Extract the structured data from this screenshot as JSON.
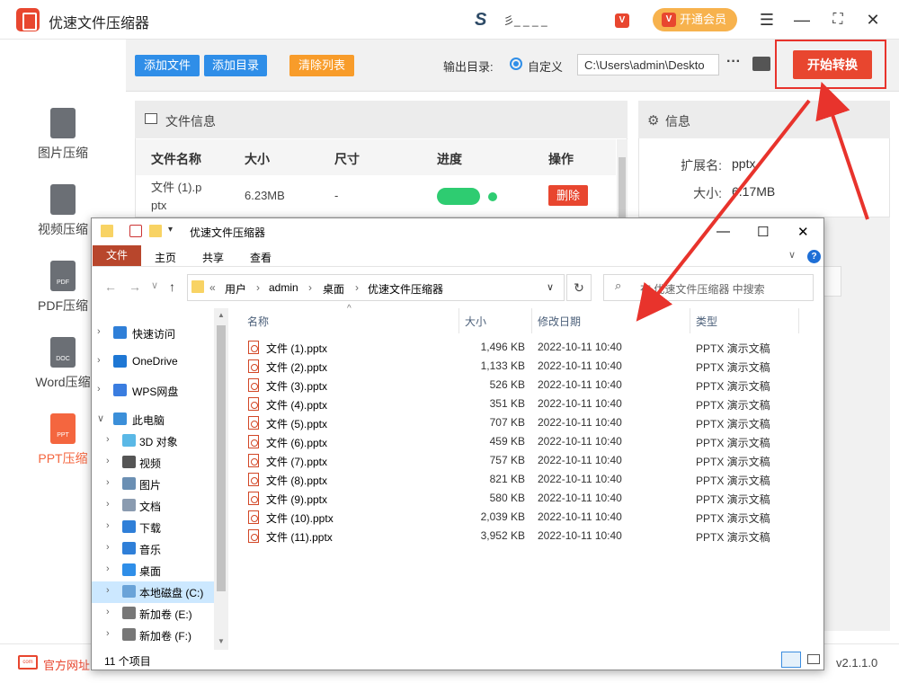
{
  "app": {
    "title": "优速文件压缩器",
    "user_name": "彡_ _ _ _",
    "vip_badge": "V",
    "vip_button": "开通会员",
    "vip_k": "V",
    "controls": {
      "menu": "☰",
      "minimize": "—",
      "maximize": "⛶",
      "close": "✕"
    }
  },
  "nav": {
    "items": [
      {
        "label": "图片压缩",
        "icon": "image-file-icon",
        "active": false
      },
      {
        "label": "视频压缩",
        "icon": "video-file-icon",
        "active": false
      },
      {
        "label": "PDF压缩",
        "icon": "pdf-file-icon",
        "icon_text": "PDF",
        "active": false
      },
      {
        "label": "Word压缩",
        "icon": "doc-file-icon",
        "icon_text": "DOC",
        "active": false
      },
      {
        "label": "PPT压缩",
        "icon": "ppt-file-icon",
        "icon_text": "PPT",
        "active": true
      }
    ]
  },
  "toolbar": {
    "add_file": "添加文件",
    "add_folder": "添加目录",
    "clear_list": "清除列表",
    "output_label": "输出目录:",
    "radio_label": "自定义",
    "output_path": "C:\\Users\\admin\\Deskto",
    "more": "···",
    "start": "开始转换"
  },
  "file_panel": {
    "title": "文件信息",
    "columns": [
      "文件名称",
      "大小",
      "尺寸",
      "进度",
      "操作"
    ],
    "row": {
      "name": "文件 (1).p\nptx",
      "size": "6.23MB",
      "dims": "-",
      "action": "删除"
    }
  },
  "info_panel": {
    "title": "信息",
    "ext_label": "扩展名:",
    "ext_value": "pptx",
    "size_label": "大小:",
    "size_value": "6.17MB"
  },
  "bottom": {
    "site_label": "官方网址",
    "site_icon": "com",
    "version": "v2.1.1.0"
  },
  "explorer": {
    "title": "优速文件压缩器",
    "ribbon_tabs": [
      "文件",
      "主页",
      "共享",
      "查看"
    ],
    "breadcrumb": [
      "«",
      "用户",
      "›",
      "admin",
      "›",
      "桌面",
      "›",
      "优速文件压缩器"
    ],
    "search_placeholder": "在 优速文件压缩器 中搜索",
    "columns": {
      "name": "名称",
      "size": "大小",
      "date": "修改日期",
      "type": "类型"
    },
    "tree": [
      {
        "label": "快速访问",
        "icon": "star-icon",
        "color": "#2f7fd8",
        "indent": 0,
        "selected": false,
        "expanded": false
      },
      {
        "label": "OneDrive",
        "icon": "cloud-icon",
        "color": "#1e77d4",
        "indent": 0,
        "selected": false,
        "expanded": false
      },
      {
        "label": "WPS网盘",
        "icon": "wps-cloud-icon",
        "color": "#3a7de0",
        "indent": 0,
        "selected": false,
        "expanded": false
      },
      {
        "label": "此电脑",
        "icon": "computer-icon",
        "color": "#3b8fd9",
        "indent": 0,
        "selected": false,
        "expanded": true
      },
      {
        "label": "3D 对象",
        "icon": "3d-objects-icon",
        "color": "#5ab8e6",
        "indent": 1,
        "selected": false,
        "expanded": false
      },
      {
        "label": "视频",
        "icon": "video-folder-icon",
        "color": "#555555",
        "indent": 1,
        "selected": false,
        "expanded": false
      },
      {
        "label": "图片",
        "icon": "pictures-folder-icon",
        "color": "#6b8fb3",
        "indent": 1,
        "selected": false,
        "expanded": false
      },
      {
        "label": "文档",
        "icon": "documents-folder-icon",
        "color": "#8a9bb0",
        "indent": 1,
        "selected": false,
        "expanded": false
      },
      {
        "label": "下载",
        "icon": "downloads-folder-icon",
        "color": "#2f7fd8",
        "indent": 1,
        "selected": false,
        "expanded": false
      },
      {
        "label": "音乐",
        "icon": "music-folder-icon",
        "color": "#2f7fd8",
        "indent": 1,
        "selected": false,
        "expanded": false
      },
      {
        "label": "桌面",
        "icon": "desktop-folder-icon",
        "color": "#2f8ee8",
        "indent": 1,
        "selected": false,
        "expanded": false
      },
      {
        "label": "本地磁盘 (C:)",
        "icon": "drive-c-icon",
        "color": "#6aa3d8",
        "indent": 1,
        "selected": true,
        "expanded": false
      },
      {
        "label": "新加卷 (E:)",
        "icon": "drive-e-icon",
        "color": "#777777",
        "indent": 1,
        "selected": false,
        "expanded": false
      },
      {
        "label": "新加卷 (F:)",
        "icon": "drive-f-icon",
        "color": "#777777",
        "indent": 1,
        "selected": false,
        "expanded": false
      }
    ],
    "files": [
      {
        "name": "文件 (1).pptx",
        "size": "1,496 KB",
        "date": "2022-10-11 10:40",
        "type": "PPTX 演示文稿"
      },
      {
        "name": "文件 (2).pptx",
        "size": "1,133 KB",
        "date": "2022-10-11 10:40",
        "type": "PPTX 演示文稿"
      },
      {
        "name": "文件 (3).pptx",
        "size": "526 KB",
        "date": "2022-10-11 10:40",
        "type": "PPTX 演示文稿"
      },
      {
        "name": "文件 (4).pptx",
        "size": "351 KB",
        "date": "2022-10-11 10:40",
        "type": "PPTX 演示文稿"
      },
      {
        "name": "文件 (5).pptx",
        "size": "707 KB",
        "date": "2022-10-11 10:40",
        "type": "PPTX 演示文稿"
      },
      {
        "name": "文件 (6).pptx",
        "size": "459 KB",
        "date": "2022-10-11 10:40",
        "type": "PPTX 演示文稿"
      },
      {
        "name": "文件 (7).pptx",
        "size": "757 KB",
        "date": "2022-10-11 10:40",
        "type": "PPTX 演示文稿"
      },
      {
        "name": "文件 (8).pptx",
        "size": "821 KB",
        "date": "2022-10-11 10:40",
        "type": "PPTX 演示文稿"
      },
      {
        "name": "文件 (9).pptx",
        "size": "580 KB",
        "date": "2022-10-11 10:40",
        "type": "PPTX 演示文稿"
      },
      {
        "name": "文件 (10).pptx",
        "size": "2,039 KB",
        "date": "2022-10-11 10:40",
        "type": "PPTX 演示文稿"
      },
      {
        "name": "文件 (11).pptx",
        "size": "3,952 KB",
        "date": "2022-10-11 10:40",
        "type": "PPTX 演示文稿"
      }
    ],
    "status": "11 个项目"
  },
  "colors": {
    "accent_red": "#e8462f",
    "accent_blue": "#2f8ee8",
    "accent_orange": "#f89c2a",
    "vip_gold": "#f7b24d"
  }
}
